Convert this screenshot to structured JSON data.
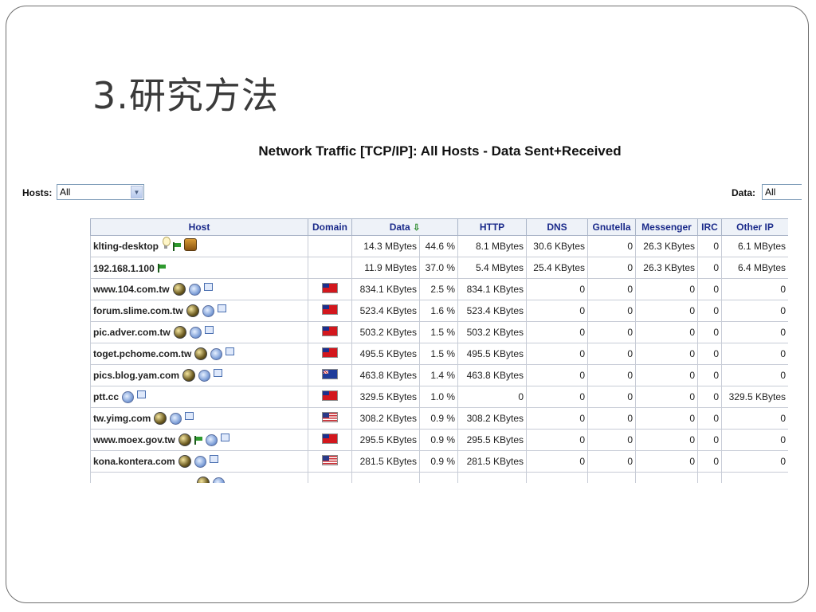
{
  "slide": {
    "title": "3.研究方法"
  },
  "report": {
    "title": "Network Traffic [TCP/IP]: All Hosts - Data Sent+Received"
  },
  "filters": {
    "hosts_label": "Hosts:",
    "hosts_value": "All",
    "data_label": "Data:",
    "data_value": "All"
  },
  "table": {
    "headers": {
      "host": "Host",
      "domain": "Domain",
      "data": "Data",
      "http": "HTTP",
      "dns": "DNS",
      "gnutella": "Gnutella",
      "messenger": "Messenger",
      "irc": "IRC",
      "other_ip": "Other IP"
    },
    "sort_icon": "sort-down-arrow-icon",
    "rows": [
      {
        "host": "klting-desktop",
        "domain": "",
        "data": "14.3 MBytes",
        "pct": "44.6 %",
        "http": "8.1 MBytes",
        "dns": "30.6 KBytes",
        "gnutella": "0",
        "messenger": "26.3 KBytes",
        "irc": "0",
        "other_ip": "6.1 MBytes"
      },
      {
        "host": "192.168.1.100",
        "domain": "",
        "data": "11.9 MBytes",
        "pct": "37.0 %",
        "http": "5.4 MBytes",
        "dns": "25.4 KBytes",
        "gnutella": "0",
        "messenger": "26.3 KBytes",
        "irc": "0",
        "other_ip": "6.4 MBytes"
      },
      {
        "host": "www.104.com.tw",
        "domain": "tw",
        "data": "834.1 KBytes",
        "pct": "2.5 %",
        "http": "834.1 KBytes",
        "dns": "0",
        "gnutella": "0",
        "messenger": "0",
        "irc": "0",
        "other_ip": "0"
      },
      {
        "host": "forum.slime.com.tw",
        "domain": "tw",
        "data": "523.4 KBytes",
        "pct": "1.6 %",
        "http": "523.4 KBytes",
        "dns": "0",
        "gnutella": "0",
        "messenger": "0",
        "irc": "0",
        "other_ip": "0"
      },
      {
        "host": "pic.adver.com.tw",
        "domain": "tw",
        "data": "503.2 KBytes",
        "pct": "1.5 %",
        "http": "503.2 KBytes",
        "dns": "0",
        "gnutella": "0",
        "messenger": "0",
        "irc": "0",
        "other_ip": "0"
      },
      {
        "host": "toget.pchome.com.tw",
        "domain": "tw",
        "data": "495.5 KBytes",
        "pct": "1.5 %",
        "http": "495.5 KBytes",
        "dns": "0",
        "gnutella": "0",
        "messenger": "0",
        "irc": "0",
        "other_ip": "0"
      },
      {
        "host": "pics.blog.yam.com",
        "domain": "au",
        "data": "463.8 KBytes",
        "pct": "1.4 %",
        "http": "463.8 KBytes",
        "dns": "0",
        "gnutella": "0",
        "messenger": "0",
        "irc": "0",
        "other_ip": "0"
      },
      {
        "host": "ptt.cc",
        "domain": "tw",
        "data": "329.5 KBytes",
        "pct": "1.0 %",
        "http": "0",
        "dns": "0",
        "gnutella": "0",
        "messenger": "0",
        "irc": "0",
        "other_ip": "329.5 KBytes"
      },
      {
        "host": "tw.yimg.com",
        "domain": "us",
        "data": "308.2 KBytes",
        "pct": "0.9 %",
        "http": "308.2 KBytes",
        "dns": "0",
        "gnutella": "0",
        "messenger": "0",
        "irc": "0",
        "other_ip": "0"
      },
      {
        "host": "www.moex.gov.tw",
        "domain": "tw",
        "data": "295.5 KBytes",
        "pct": "0.9 %",
        "http": "295.5 KBytes",
        "dns": "0",
        "gnutella": "0",
        "messenger": "0",
        "irc": "0",
        "other_ip": "0"
      },
      {
        "host": "kona.kontera.com",
        "domain": "us",
        "data": "281.5 KBytes",
        "pct": "0.9 %",
        "http": "281.5 KBytes",
        "dns": "0",
        "gnutella": "0",
        "messenger": "0",
        "irc": "0",
        "other_ip": "0"
      }
    ]
  }
}
